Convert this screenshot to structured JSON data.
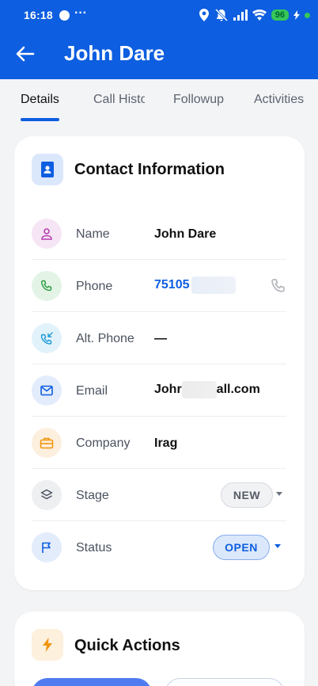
{
  "status_bar": {
    "time": "16:18",
    "more": "···",
    "battery": "96"
  },
  "app_bar": {
    "title": "John Dare"
  },
  "tabs": [
    {
      "label": "Details",
      "active": true
    },
    {
      "label": "Call History",
      "active": false
    },
    {
      "label": "Followup",
      "active": false
    },
    {
      "label": "Activities",
      "active": false
    }
  ],
  "contact_card": {
    "title": "Contact Information",
    "rows": [
      {
        "label": "Name",
        "value": "John Dare",
        "icon": "person-icon"
      },
      {
        "label": "Phone",
        "value": "75105",
        "icon": "phone-icon"
      },
      {
        "label": "Alt. Phone",
        "value": "—",
        "icon": "phone-incoming-icon"
      },
      {
        "label": "Email",
        "value_start": "Johr",
        "value_end": "all.com",
        "icon": "mail-icon"
      },
      {
        "label": "Company",
        "value": "Irag",
        "icon": "briefcase-icon"
      },
      {
        "label": "Stage",
        "value": "NEW",
        "icon": "layers-icon"
      },
      {
        "label": "Status",
        "value": "OPEN",
        "icon": "flag-icon"
      }
    ]
  },
  "quick_actions": {
    "title": "Quick Actions"
  },
  "colors": {
    "primary": "#0d5ee0",
    "open_chip_bg": "#dbe8fb",
    "battery": "#35c759"
  }
}
